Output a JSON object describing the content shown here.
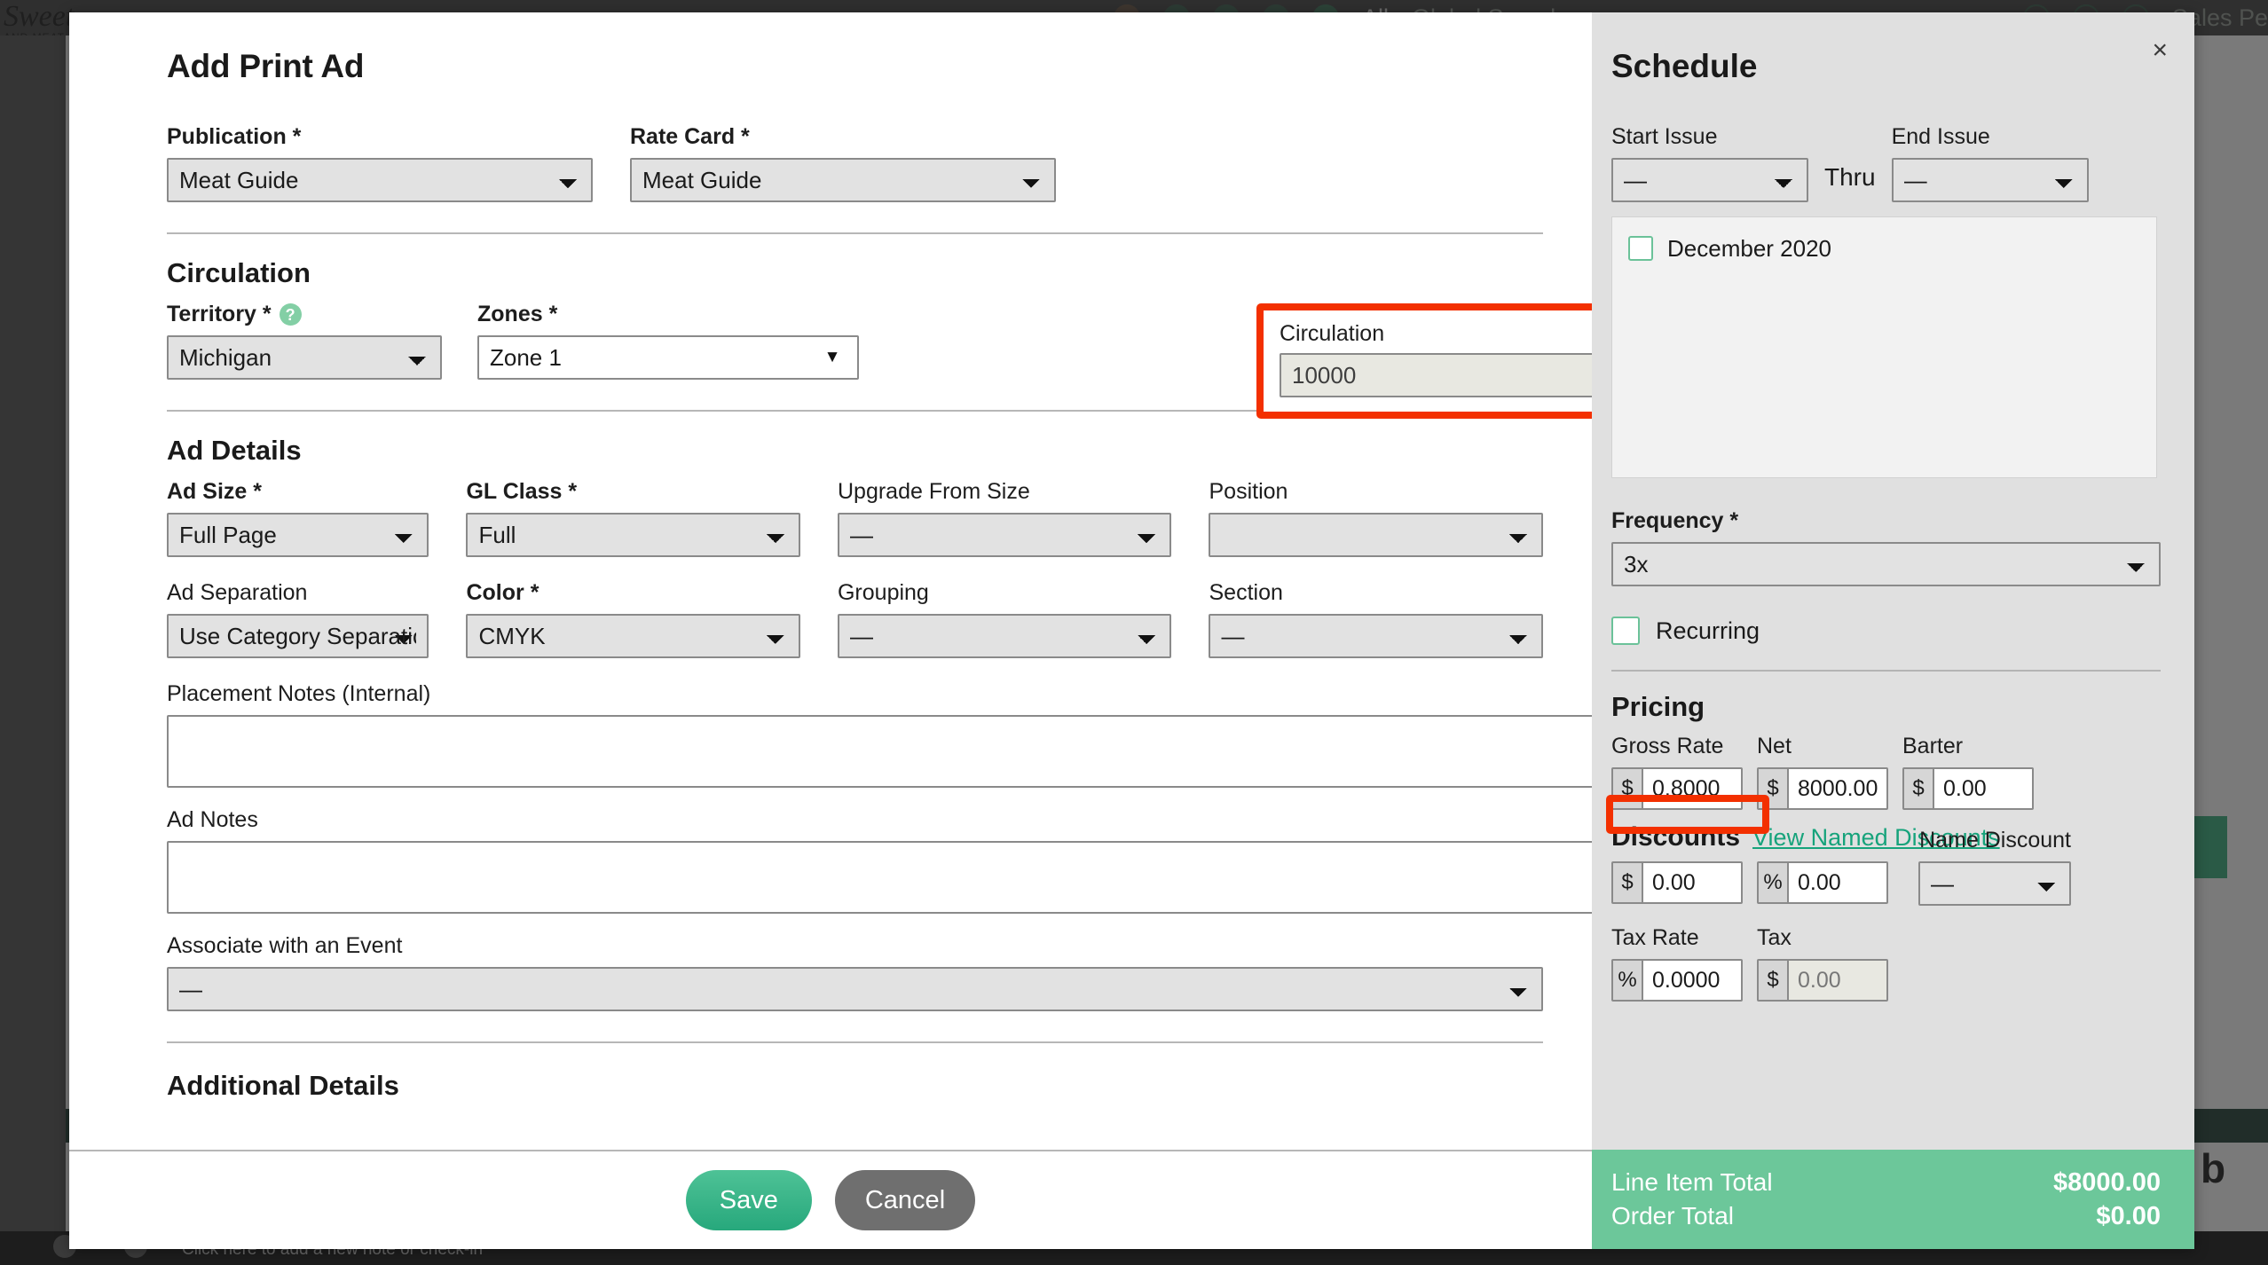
{
  "background": {
    "logo_main": "Sweet",
    "logo_sub": "AND MEAT",
    "topbar": {
      "scope_label": "All",
      "search_placeholder": "Global Search",
      "account_label": "Sales Pe",
      "icons": [
        "party-icon",
        "filter-icon",
        "link-icon",
        "clock-icon",
        "person-icon"
      ],
      "right_icons": [
        "search-icon",
        "help-icon",
        "user-icon"
      ]
    },
    "footer_text": "Click here to add a new note or check-in",
    "right_letter": "b"
  },
  "modal": {
    "title": "Add Print Ad",
    "close_label": "×",
    "publication": {
      "label": "Publication *",
      "value": "Meat Guide",
      "options": [
        "Meat Guide"
      ]
    },
    "rate_card": {
      "label": "Rate Card *",
      "value": "Meat Guide",
      "options": [
        "Meat Guide"
      ]
    },
    "circulation_section": {
      "heading": "Circulation",
      "territory": {
        "label": "Territory *",
        "help_icon": "question-mark-icon",
        "value": "Michigan",
        "options": [
          "Michigan"
        ]
      },
      "zones": {
        "label": "Zones *",
        "value": "Zone 1",
        "options": [
          "Zone 1"
        ]
      },
      "circulation": {
        "label": "Circulation",
        "value": "10000",
        "highlighted": true,
        "highlight_color": "#f33000",
        "disabled": true
      }
    },
    "ad_details": {
      "heading": "Ad Details",
      "fields": [
        {
          "label": "Ad Size *",
          "value": "Full Page",
          "options": [
            "Full Page"
          ]
        },
        {
          "label": "GL Class *",
          "value": "Full",
          "options": [
            "Full"
          ]
        },
        {
          "label": "Upgrade From Size",
          "value": "—",
          "options": [
            "—"
          ]
        },
        {
          "label": "Position",
          "value": "",
          "options": [
            ""
          ]
        },
        {
          "label": "Ad Separation",
          "value": "Use Category Separation",
          "options": [
            "Use Category Separation"
          ]
        },
        {
          "label": "Color *",
          "value": "CMYK",
          "options": [
            "CMYK"
          ]
        },
        {
          "label": "Grouping",
          "value": "—",
          "options": [
            "—"
          ]
        },
        {
          "label": "Section",
          "value": "—",
          "options": [
            "—"
          ]
        }
      ],
      "placement_notes": {
        "label": "Placement Notes (Internal)",
        "value": ""
      },
      "ad_notes": {
        "label": "Ad Notes",
        "value": ""
      },
      "associate_event": {
        "label": "Associate with an Event",
        "value": "—",
        "options": [
          "—"
        ]
      }
    },
    "additional_details_heading": "Additional Details",
    "footer": {
      "save_label": "Save",
      "cancel_label": "Cancel"
    }
  },
  "schedule": {
    "heading": "Schedule",
    "start_issue": {
      "label": "Start Issue",
      "value": "—",
      "options": [
        "—"
      ]
    },
    "thru_label": "Thru",
    "end_issue": {
      "label": "End Issue",
      "value": "—",
      "options": [
        "—"
      ]
    },
    "issues": [
      {
        "label": "December 2020",
        "checked": false
      }
    ],
    "frequency": {
      "label": "Frequency *",
      "value": "3x",
      "options": [
        "3x"
      ]
    },
    "recurring": {
      "label": "Recurring",
      "checked": false
    }
  },
  "pricing": {
    "heading": "Pricing",
    "gross_rate": {
      "label": "Gross Rate",
      "symbol": "$",
      "value": "0.8000",
      "highlighted": true,
      "highlight_color": "#f33000"
    },
    "net": {
      "label": "Net",
      "symbol": "$",
      "value": "8000.00"
    },
    "barter": {
      "label": "Barter",
      "symbol": "$",
      "value": "0.00"
    },
    "discounts": {
      "title": "Discounts",
      "link_label": "View Named Discounts",
      "amount": {
        "symbol": "$",
        "value": "0.00"
      },
      "percent": {
        "symbol": "%",
        "value": "0.00"
      },
      "name_discount": {
        "label": "Name Discount",
        "value": "—",
        "options": [
          "—"
        ]
      }
    },
    "tax_rate": {
      "label": "Tax Rate",
      "symbol": "%",
      "value": "0.0000"
    },
    "tax": {
      "label": "Tax",
      "symbol": "$",
      "value": "0.00",
      "disabled": true
    }
  },
  "totals": {
    "line_item_label": "Line Item Total",
    "line_item_value": "$8000.00",
    "order_label": "Order Total",
    "order_value": "$0.00",
    "background_color": "#6cc79a"
  }
}
